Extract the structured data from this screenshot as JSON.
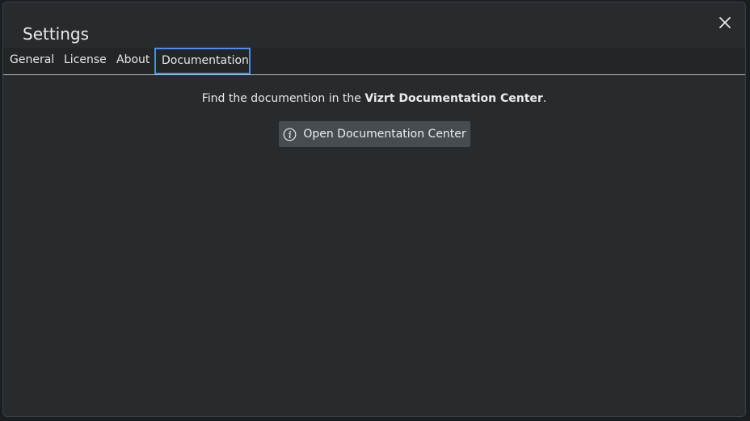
{
  "dialog": {
    "title": "Settings",
    "close_icon": "close-icon"
  },
  "tabs": [
    {
      "label": "General",
      "active": false
    },
    {
      "label": "License",
      "active": false
    },
    {
      "label": "About",
      "active": false
    },
    {
      "label": "Documentation",
      "active": true
    }
  ],
  "documentation": {
    "text_prefix": "Find the documention in the ",
    "text_bold": "Vizrt Documentation Center",
    "text_suffix": ".",
    "button_label": "Open Documentation Center",
    "button_icon": "info-icon"
  },
  "colors": {
    "active_tab_border": "#4f8ee8",
    "dialog_background": "#272b2e",
    "button_background": "#474c50"
  }
}
